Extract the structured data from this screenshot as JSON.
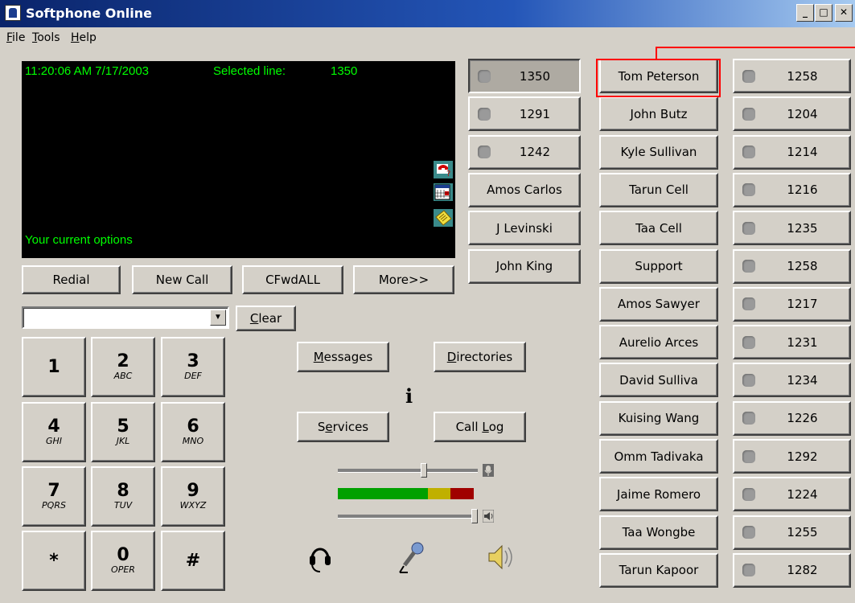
{
  "window": {
    "title": "Softphone Online",
    "minimize": "_",
    "maximize": "□",
    "close": "✕"
  },
  "menu": [
    {
      "label": "File",
      "accel": "F",
      "rest": "ile"
    },
    {
      "label": "Tools",
      "accel": "T",
      "rest": "ools"
    },
    {
      "label": "Help",
      "accel": "H",
      "rest": "elp"
    }
  ],
  "display": {
    "time": "11:20:06 AM 7/17/2003",
    "selected_label": "Selected line:",
    "selected_value": "1350",
    "options_text": "Your current options",
    "text_color": "#00ff00"
  },
  "softkeys": [
    "Redial",
    "New Call",
    "CFwdALL",
    "More>>"
  ],
  "dial": {
    "value": "",
    "clear_label": "Clear",
    "clear_accel": "C",
    "clear_rest": "lear"
  },
  "keypad": [
    {
      "digit": "1",
      "letters": ""
    },
    {
      "digit": "2",
      "letters": "ABC"
    },
    {
      "digit": "3",
      "letters": "DEF"
    },
    {
      "digit": "4",
      "letters": "GHI"
    },
    {
      "digit": "5",
      "letters": "JKL"
    },
    {
      "digit": "6",
      "letters": "MNO"
    },
    {
      "digit": "7",
      "letters": "PQRS"
    },
    {
      "digit": "8",
      "letters": "TUV"
    },
    {
      "digit": "9",
      "letters": "WXYZ"
    },
    {
      "digit": "*",
      "letters": ""
    },
    {
      "digit": "0",
      "letters": "OPER"
    },
    {
      "digit": "#",
      "letters": ""
    }
  ],
  "functions": {
    "messages": {
      "accel": "M",
      "rest": "essages"
    },
    "directories": {
      "accel": "D",
      "rest": "irectories"
    },
    "services": {
      "pre": "S",
      "accel": "e",
      "rest": "rvices"
    },
    "call_log": {
      "pre": "Call ",
      "accel": "L",
      "rest": "og"
    },
    "info": "i"
  },
  "audio": {
    "mic_level": 0.62,
    "speaker_level": 1.0,
    "meter_colors": [
      "#00a000",
      "#c0b000",
      "#a00000"
    ]
  },
  "lines": [
    {
      "label": "1350",
      "selected": true
    },
    {
      "label": "1291"
    },
    {
      "label": "1242"
    }
  ],
  "speed_dials_col1": [
    "Amos Carlos",
    "J Levinski",
    "John King"
  ],
  "speed_dials_col2": [
    "Tom Peterson",
    "John Butz",
    "Kyle Sullivan",
    "Tarun Cell",
    "Taa Cell",
    "Support",
    "Amos Sawyer",
    "Aurelio Arces",
    "David Sulliva",
    "Kuising Wang",
    "Omm Tadivaka",
    "Jaime Romero",
    "Taa Wongbe",
    "Tarun Kapoor"
  ],
  "extensions_col3": [
    "1258",
    "1204",
    "1214",
    "1216",
    "1235",
    "1258",
    "1217",
    "1231",
    "1234",
    "1226",
    "1292",
    "1224",
    "1255",
    "1282"
  ],
  "highlight_color": "#ff0000"
}
